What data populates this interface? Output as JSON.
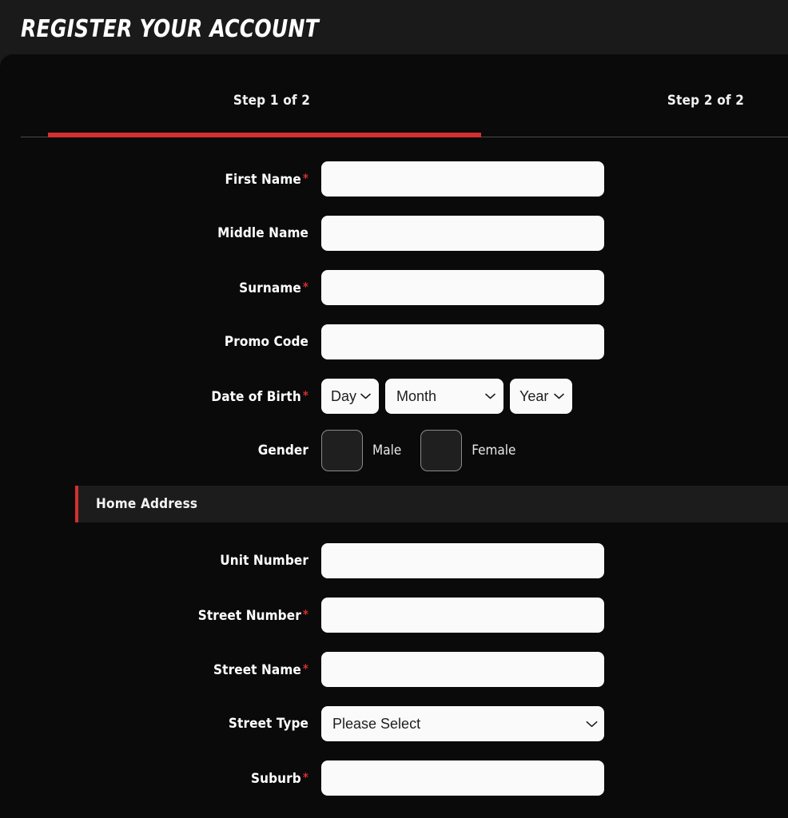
{
  "header": {
    "title": "REGISTER YOUR ACCOUNT"
  },
  "steps": {
    "tabs": [
      {
        "label": "Step 1 of 2",
        "active": true
      },
      {
        "label": "Step 2 of 2",
        "active": false
      }
    ],
    "progress_percent": 50,
    "accent_color": "#d32f2f"
  },
  "form": {
    "required_marker": "*",
    "personal": [
      {
        "label": "First Name",
        "required": true,
        "value": "",
        "placeholder": ""
      },
      {
        "label": "Middle Name",
        "required": false,
        "value": "",
        "placeholder": ""
      },
      {
        "label": "Surname",
        "required": true,
        "value": "",
        "placeholder": ""
      },
      {
        "label": "Promo Code",
        "required": false,
        "value": "",
        "placeholder": ""
      }
    ],
    "date_of_birth": {
      "label": "Date of Birth",
      "required": true,
      "day": {
        "value": "Day",
        "options": [
          "Day"
        ]
      },
      "month": {
        "value": "Month",
        "options": [
          "Month"
        ]
      },
      "year": {
        "value": "Year",
        "options": [
          "Year"
        ]
      }
    },
    "gender": {
      "label": "Gender",
      "required": false,
      "options": [
        {
          "label": "Male",
          "checked": false
        },
        {
          "label": "Female",
          "checked": false
        }
      ]
    },
    "home_address": {
      "section_title": "Home Address",
      "fields": [
        {
          "label": "Unit Number",
          "required": false,
          "type": "text",
          "value": ""
        },
        {
          "label": "Street Number",
          "required": true,
          "type": "text",
          "value": ""
        },
        {
          "label": "Street Name",
          "required": true,
          "type": "text",
          "value": ""
        },
        {
          "label": "Street Type",
          "required": false,
          "type": "select",
          "value": "Please Select"
        },
        {
          "label": "Suburb",
          "required": true,
          "type": "text",
          "value": ""
        }
      ]
    }
  },
  "colors": {
    "page_background": "#1a1a1a",
    "panel_background": "#0a0a0a",
    "section_background": "#1c1c1c",
    "input_background": "#fafafa",
    "accent_red": "#d32f2f",
    "text_primary": "#ffffff"
  }
}
